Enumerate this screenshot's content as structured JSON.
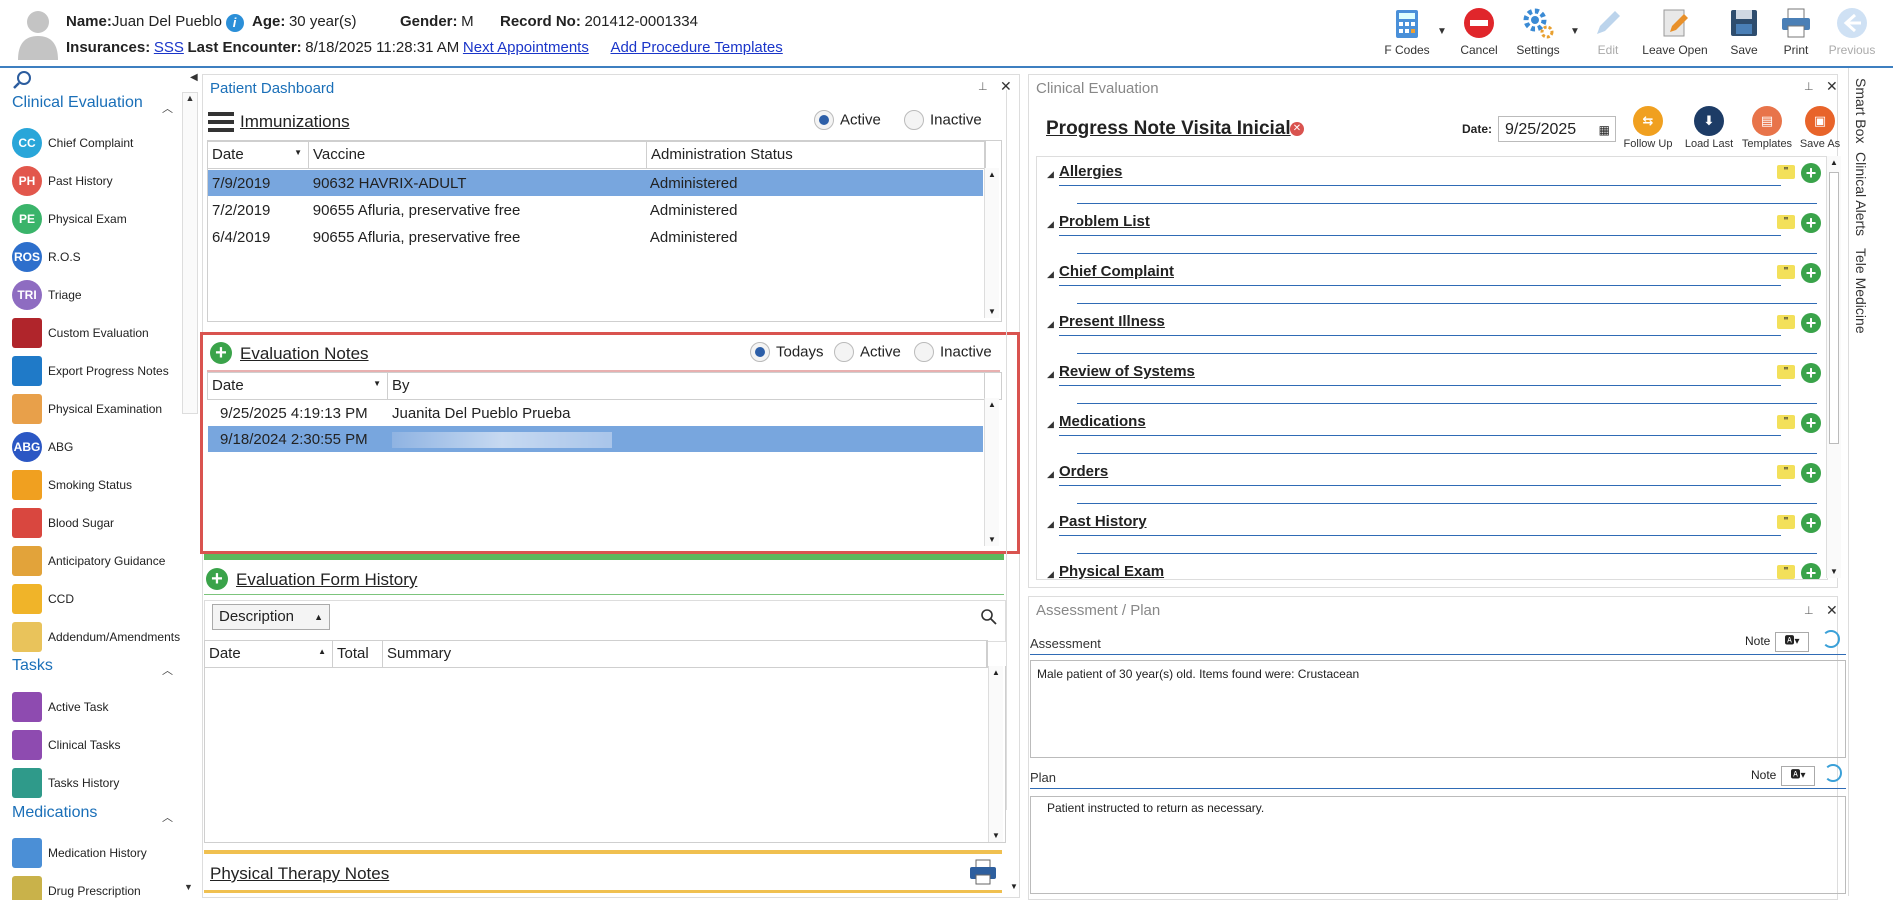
{
  "header": {
    "name_label": "Name:",
    "name_value": "Juan Del Pueblo",
    "age_label": "Age:",
    "age_value": "30 year(s)",
    "gender_label": "Gender:",
    "gender_value": "M",
    "record_label": "Record No:",
    "record_value": "201412-0001334",
    "insurances_label": "Insurances:",
    "insurances_value": "SSS",
    "last_encounter_label": "Last Encounter:",
    "last_encounter_value": "8/18/2025 11:28:31 AM",
    "next_appointments": "Next Appointments",
    "add_procedure_templates": "Add Procedure Templates"
  },
  "toolbar": {
    "fcodes": "F Codes",
    "cancel": "Cancel",
    "settings": "Settings",
    "edit": "Edit",
    "leave_open": "Leave Open",
    "save": "Save",
    "print": "Print",
    "previous": "Previous"
  },
  "sidebar": {
    "clinical_evaluation": "Clinical Evaluation",
    "items": [
      {
        "label": "Chief Complaint",
        "icon": "CC",
        "color": "#29a6d9"
      },
      {
        "label": "Past History",
        "icon": "PH",
        "color": "#e2574c"
      },
      {
        "label": "Physical Exam",
        "icon": "PE",
        "color": "#3ab46a"
      },
      {
        "label": "R.O.S",
        "icon": "ROS",
        "color": "#2d6fcc"
      },
      {
        "label": "Triage",
        "icon": "TRI",
        "color": "#8e6cc1"
      },
      {
        "label": "Custom Evaluation",
        "icon": "stethoscope",
        "color": "#b0252b"
      },
      {
        "label": "Export Progress Notes",
        "icon": "export",
        "color": "#1f7ac8"
      },
      {
        "label": "Physical Examination",
        "icon": "clipboard",
        "color": "#e8a04a"
      },
      {
        "label": "ABG",
        "icon": "ABG",
        "color": "#2b57c4"
      },
      {
        "label": "Smoking Status",
        "icon": "no-smoking",
        "color": "#f0a020"
      },
      {
        "label": "Blood Sugar",
        "icon": "blood-drop",
        "color": "#d9473f"
      },
      {
        "label": "Anticipatory Guidance",
        "icon": "chart",
        "color": "#e2a33a"
      },
      {
        "label": "CCD",
        "icon": "folder",
        "color": "#f0b429"
      },
      {
        "label": "Addendum/Amendments",
        "icon": "document",
        "color": "#e9c35b"
      }
    ],
    "tasks": "Tasks",
    "task_items": [
      {
        "label": "Active Task",
        "icon": "task",
        "color": "#8e4bb0"
      },
      {
        "label": "Clinical Tasks",
        "icon": "task",
        "color": "#8e4bb0"
      },
      {
        "label": "Tasks History",
        "icon": "checklist",
        "color": "#2f9a8a"
      }
    ],
    "medications": "Medications",
    "med_items": [
      {
        "label": "Medication History",
        "icon": "pills",
        "color": "#4b8fd6"
      },
      {
        "label": "Drug Prescription",
        "icon": "pen",
        "color": "#c9b24a"
      }
    ]
  },
  "dashboard": {
    "title": "Patient Dashboard",
    "immunizations": {
      "title": "Immunizations",
      "radio_active": "Active",
      "radio_inactive": "Inactive",
      "columns": [
        "Date",
        "Vaccine",
        "Administration Status"
      ],
      "rows": [
        [
          "7/9/2019",
          "90632 HAVRIX-ADULT",
          "Administered"
        ],
        [
          "7/2/2019",
          "90655 Afluria, preservative free",
          "Administered"
        ],
        [
          "6/4/2019",
          "90655 Afluria, preservative free",
          "Administered"
        ]
      ]
    },
    "evaluation_notes": {
      "title": "Evaluation Notes",
      "radio_todays": "Todays",
      "radio_active": "Active",
      "radio_inactive": "Inactive",
      "columns": [
        "Date",
        "By"
      ],
      "rows": [
        [
          "9/25/2025 4:19:13 PM",
          "Juanita Del Pueblo Prueba"
        ],
        [
          "9/18/2024 2:30:55 PM",
          ""
        ]
      ]
    },
    "evaluation_form_history": {
      "title": "Evaluation Form History",
      "dropdown": "Description",
      "columns": [
        "Date",
        "Total",
        "Summary"
      ]
    },
    "physical_therapy_notes": "Physical Therapy Notes"
  },
  "clinical_evaluation": {
    "panel_title": "Clinical Evaluation",
    "note_title": "Progress Note Visita Inicial",
    "date_label": "Date:",
    "date_value": "9/25/2025",
    "buttons": [
      "Follow Up",
      "Load Last",
      "Templates",
      "Save As"
    ],
    "sections": [
      "Allergies",
      "Problem List",
      "Chief Complaint",
      "Present Illness",
      "Review of Systems",
      "Medications",
      "Orders",
      "Past History",
      "Physical Exam"
    ]
  },
  "assessment_plan": {
    "panel_title": "Assessment / Plan",
    "assessment_label": "Assessment",
    "note_label": "Note",
    "assessment_text": "Male patient of 30 year(s) old. Items found were:  Crustacean",
    "plan_label": "Plan",
    "plan_text": "Patient instructed to return as necessary."
  },
  "side_tabs": [
    "Smart Box",
    "Clinical Alerts",
    "Tele Medicine"
  ]
}
